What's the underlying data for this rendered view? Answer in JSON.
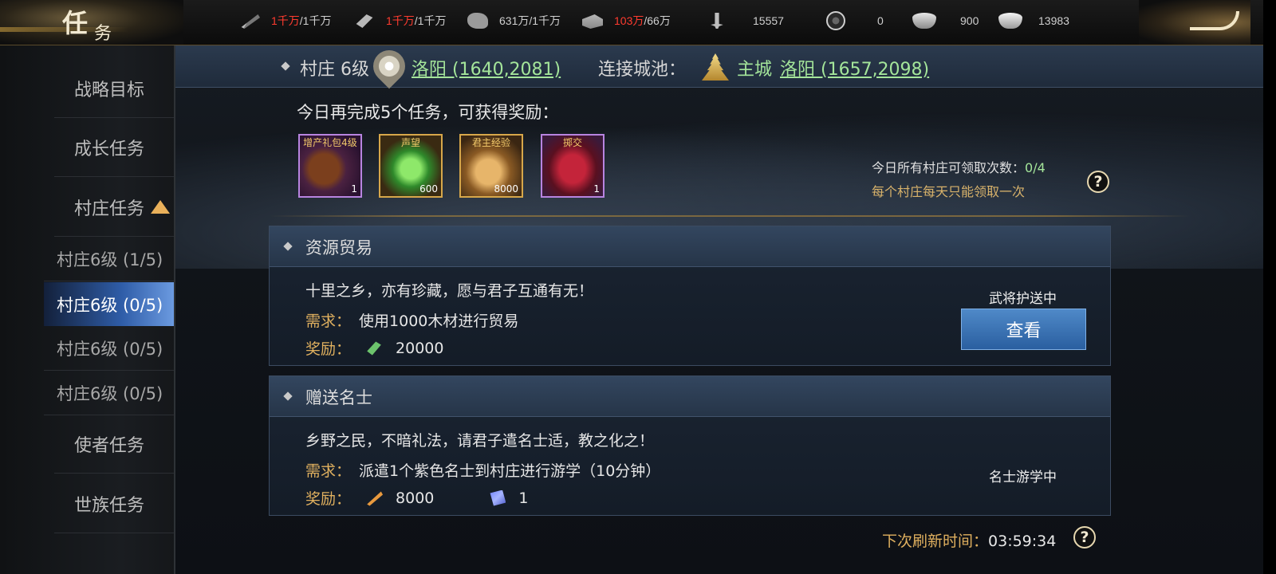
{
  "header": {
    "title_char1": "任",
    "title_char2": "务",
    "resources": [
      {
        "icon": "wheat-icon",
        "current": "1千万",
        "current_color": "#ff3b2f",
        "max": "/1千万"
      },
      {
        "icon": "wood-icon",
        "current": "1千万",
        "current_color": "#ff3b2f",
        "max": "/1千万"
      },
      {
        "icon": "stone-icon",
        "current": "631万",
        "current_color": "#cfcfcf",
        "max": "/1千万"
      },
      {
        "icon": "iron-icon",
        "current": "103万",
        "current_color": "#ff3b2f",
        "max": "/66万"
      },
      {
        "icon": "sword-icon",
        "value": "15557"
      },
      {
        "icon": "coin-icon",
        "value": "0"
      },
      {
        "icon": "gold-ingot-icon",
        "value": "900"
      },
      {
        "icon": "silver-ingot-icon",
        "value": "13983"
      }
    ]
  },
  "sidebar": {
    "items": [
      {
        "label": "战略目标"
      },
      {
        "label": "成长任务"
      },
      {
        "label": "村庄任务"
      }
    ],
    "sub_items": [
      {
        "label": "村庄6级 (1/5)"
      },
      {
        "label": "村庄6级 (0/5)",
        "active": true
      },
      {
        "label": "村庄6级 (0/5)"
      },
      {
        "label": "村庄6级 (0/5)"
      }
    ],
    "bottom_items": [
      {
        "label": "使者任务"
      },
      {
        "label": "世族任务"
      }
    ]
  },
  "village_bar": {
    "name": "村庄 6级",
    "coord": "洛阳 (1640,2081)",
    "link_label": "连接城池：",
    "main_city": "主城",
    "main_coord": "洛阳 (1657,2098)"
  },
  "daily": {
    "text": "今日再完成5个任务，可获得奖励：",
    "rewards": [
      {
        "tag": "增产礼包4级",
        "count": "1"
      },
      {
        "tag": "声望",
        "count": "600"
      },
      {
        "tag": "君主经验",
        "count": "8000"
      },
      {
        "tag": "掷交",
        "count": "1"
      }
    ],
    "claim_label": "今日所有村庄可领取次数：",
    "claim_value": "0/4",
    "claim_note": "每个村庄每天只能领取一次"
  },
  "cards": [
    {
      "title": "资源贸易",
      "desc": "十里之乡，亦有珍藏，愿与君子互通有无！",
      "req_label": "需求：",
      "req_text": "使用1000木材进行贸易",
      "reward_label": "奖励：",
      "reward_value": "20000",
      "status": "武将护送中",
      "button_label": "查看"
    },
    {
      "title": "赠送名士",
      "desc": "乡野之民，不暗礼法，请君子遣名士适，教之化之！",
      "req_label": "需求：",
      "req_text": "派遣1个紫色名士到村庄进行游学（10分钟）",
      "reward_label": "奖励：",
      "reward_value1": "8000",
      "reward_value2": "1",
      "status": "名士游学中"
    }
  ],
  "refresh": {
    "label": "下次刷新时间：",
    "time": "03:59:34"
  },
  "colors": {
    "accent_gold": "#e0b05f",
    "link_green": "#a4e59a",
    "warning_red": "#ff3b2f",
    "active_blue": "#2f5da8"
  }
}
